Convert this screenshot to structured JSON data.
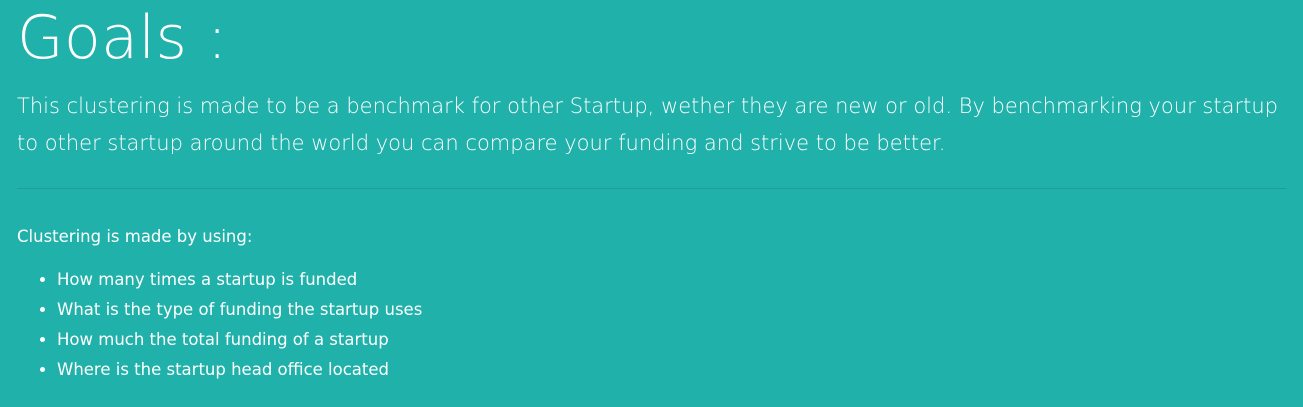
{
  "title": "Goals :",
  "lead": "This clustering is made to be a benchmark for other Startup, wether they are new or old. By benchmarking your startup to other startup around the world you can compare your funding and strive to be better.",
  "intro": "Clustering is made by using:",
  "criteria": [
    "How many times a startup is funded",
    "What is the type of funding the startup uses",
    "How much the total funding of a startup",
    "Where is the startup head office located"
  ],
  "colors": {
    "background": "#20b2aa",
    "text": "#ffffff"
  }
}
